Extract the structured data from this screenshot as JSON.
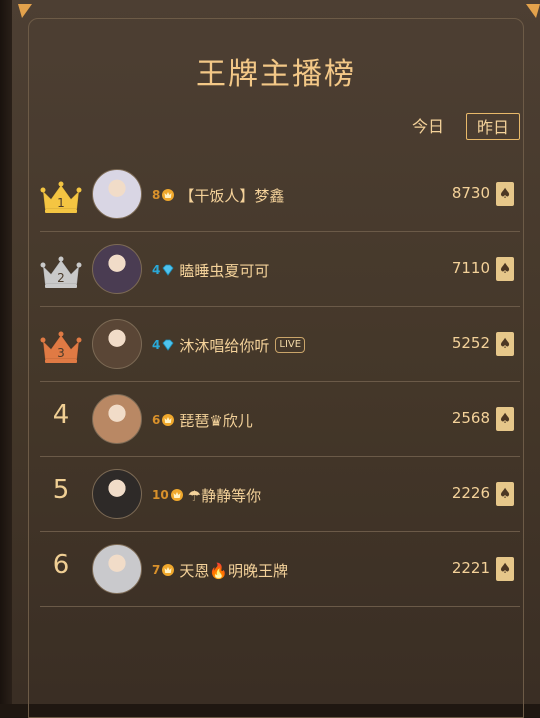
{
  "header": {
    "title": "王牌主播榜"
  },
  "tabs": [
    {
      "label": "今日",
      "active": false
    },
    {
      "label": "昨日",
      "active": true
    }
  ],
  "colors": {
    "accent": "#f3c887",
    "gold": "#f4c542",
    "silver": "#c9c9c9",
    "bronze": "#e07a44",
    "diamond": "#2aa8d6"
  },
  "rows": [
    {
      "rank": "1",
      "level": "8",
      "level_type": "crown",
      "name": "【干饭人】梦鑫",
      "score": "8730",
      "live": "",
      "avatar_color": "#d9d6e4"
    },
    {
      "rank": "2",
      "level": "4",
      "level_type": "diamond",
      "name": "瞌睡虫夏可可",
      "score": "7110",
      "live": "",
      "avatar_color": "#4a3c52"
    },
    {
      "rank": "3",
      "level": "4",
      "level_type": "diamond",
      "name": "沐沐唱给你听",
      "score": "5252",
      "live": "LIVE",
      "avatar_color": "#5a4636"
    },
    {
      "rank": "4",
      "level": "6",
      "level_type": "crown",
      "name": "琵琶♛欣儿",
      "score": "2568",
      "live": "",
      "avatar_color": "#b98864"
    },
    {
      "rank": "5",
      "level": "10",
      "level_type": "crown",
      "name": "☂静静等你",
      "score": "2226",
      "live": "",
      "avatar_color": "#2e2a28"
    },
    {
      "rank": "6",
      "level": "7",
      "level_type": "crown",
      "name": "天恩🔥明晚王牌",
      "score": "2221",
      "live": "",
      "avatar_color": "#c9c9cc"
    }
  ]
}
